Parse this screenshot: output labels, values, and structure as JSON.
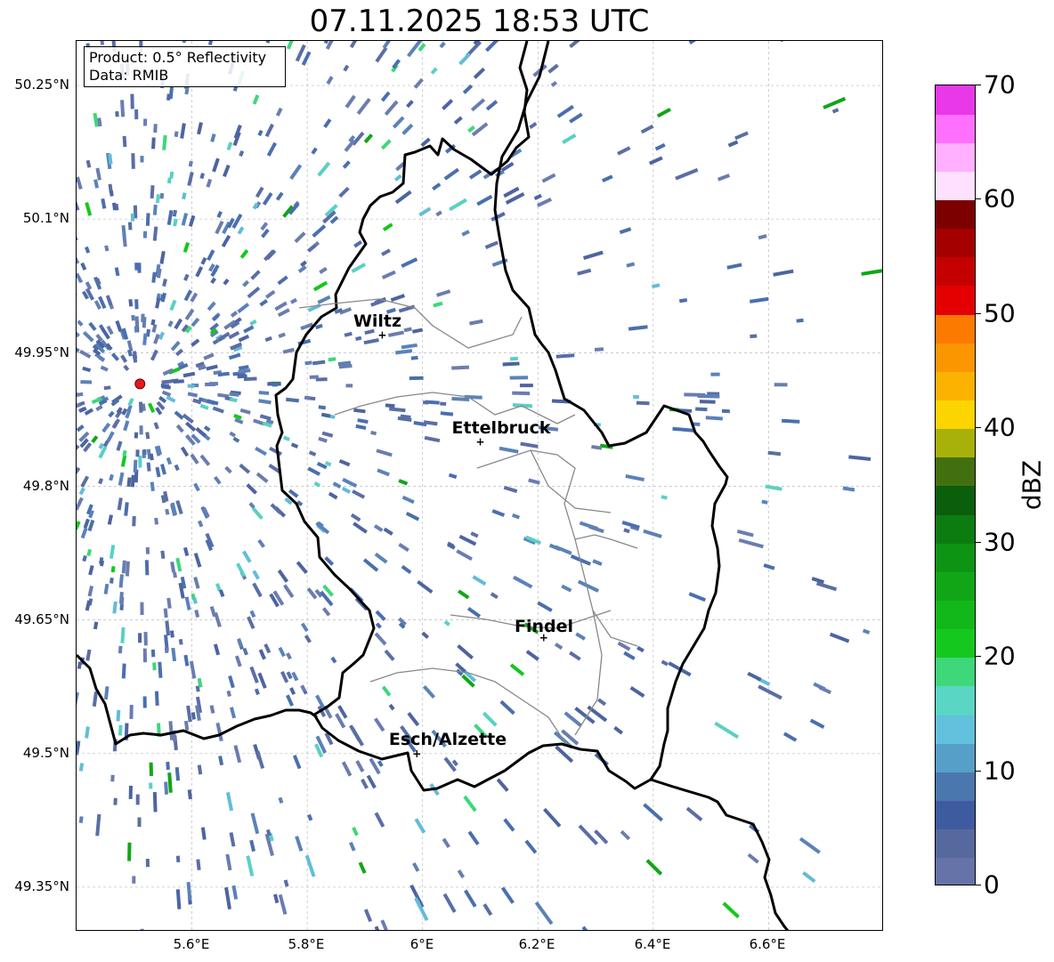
{
  "title": "07.11.2025 18:53 UTC",
  "info": {
    "product": "Product: 0.5° Reflectivity",
    "data_source": "Data: RMIB"
  },
  "axes": {
    "lat_ticks": [
      "50.25°N",
      "50.1°N",
      "49.95°N",
      "49.8°N",
      "49.65°N",
      "49.5°N",
      "49.35°N"
    ],
    "lon_ticks": [
      "5.6°E",
      "5.8°E",
      "6°E",
      "6.2°E",
      "6.4°E",
      "6.6°E"
    ],
    "grid": "dashed light grey"
  },
  "map": {
    "lon_range": [
      5.4,
      6.8
    ],
    "lat_range": [
      49.3,
      50.3
    ]
  },
  "cities": [
    {
      "name": "Wiltz",
      "lon": 5.93,
      "lat": 49.97
    },
    {
      "name": "Ettelbruck",
      "lon": 6.1,
      "lat": 49.85
    },
    {
      "name": "Findel",
      "lon": 6.21,
      "lat": 49.63
    },
    {
      "name": "Esch/Alzette",
      "lon": 5.99,
      "lat": 49.5
    }
  ],
  "radar_site": {
    "lon": 5.51,
    "lat": 49.915,
    "color": "#e31a1c"
  },
  "colorbar": {
    "label": "dBZ",
    "min": 0,
    "max": 70,
    "tick_labels": [
      "0",
      "10",
      "20",
      "30",
      "40",
      "50",
      "60",
      "70"
    ],
    "tick_values": [
      0,
      10,
      20,
      30,
      40,
      50,
      60,
      70
    ],
    "colors": [
      "#6673a8",
      "#56699e",
      "#3f5ba0",
      "#4a78ae",
      "#569fc8",
      "#62c1dc",
      "#5ad6c4",
      "#3ed77a",
      "#14c81e",
      "#12b81a",
      "#10a616",
      "#0e9414",
      "#0c7c10",
      "#0a5e0c",
      "#43700f",
      "#a8b00a",
      "#fcd400",
      "#fcb200",
      "#fc9600",
      "#fc7a00",
      "#e40000",
      "#c40000",
      "#a40000",
      "#7c0000",
      "#ffe0ff",
      "#ffb0ff",
      "#ff70ff",
      "#e838e8"
    ]
  }
}
